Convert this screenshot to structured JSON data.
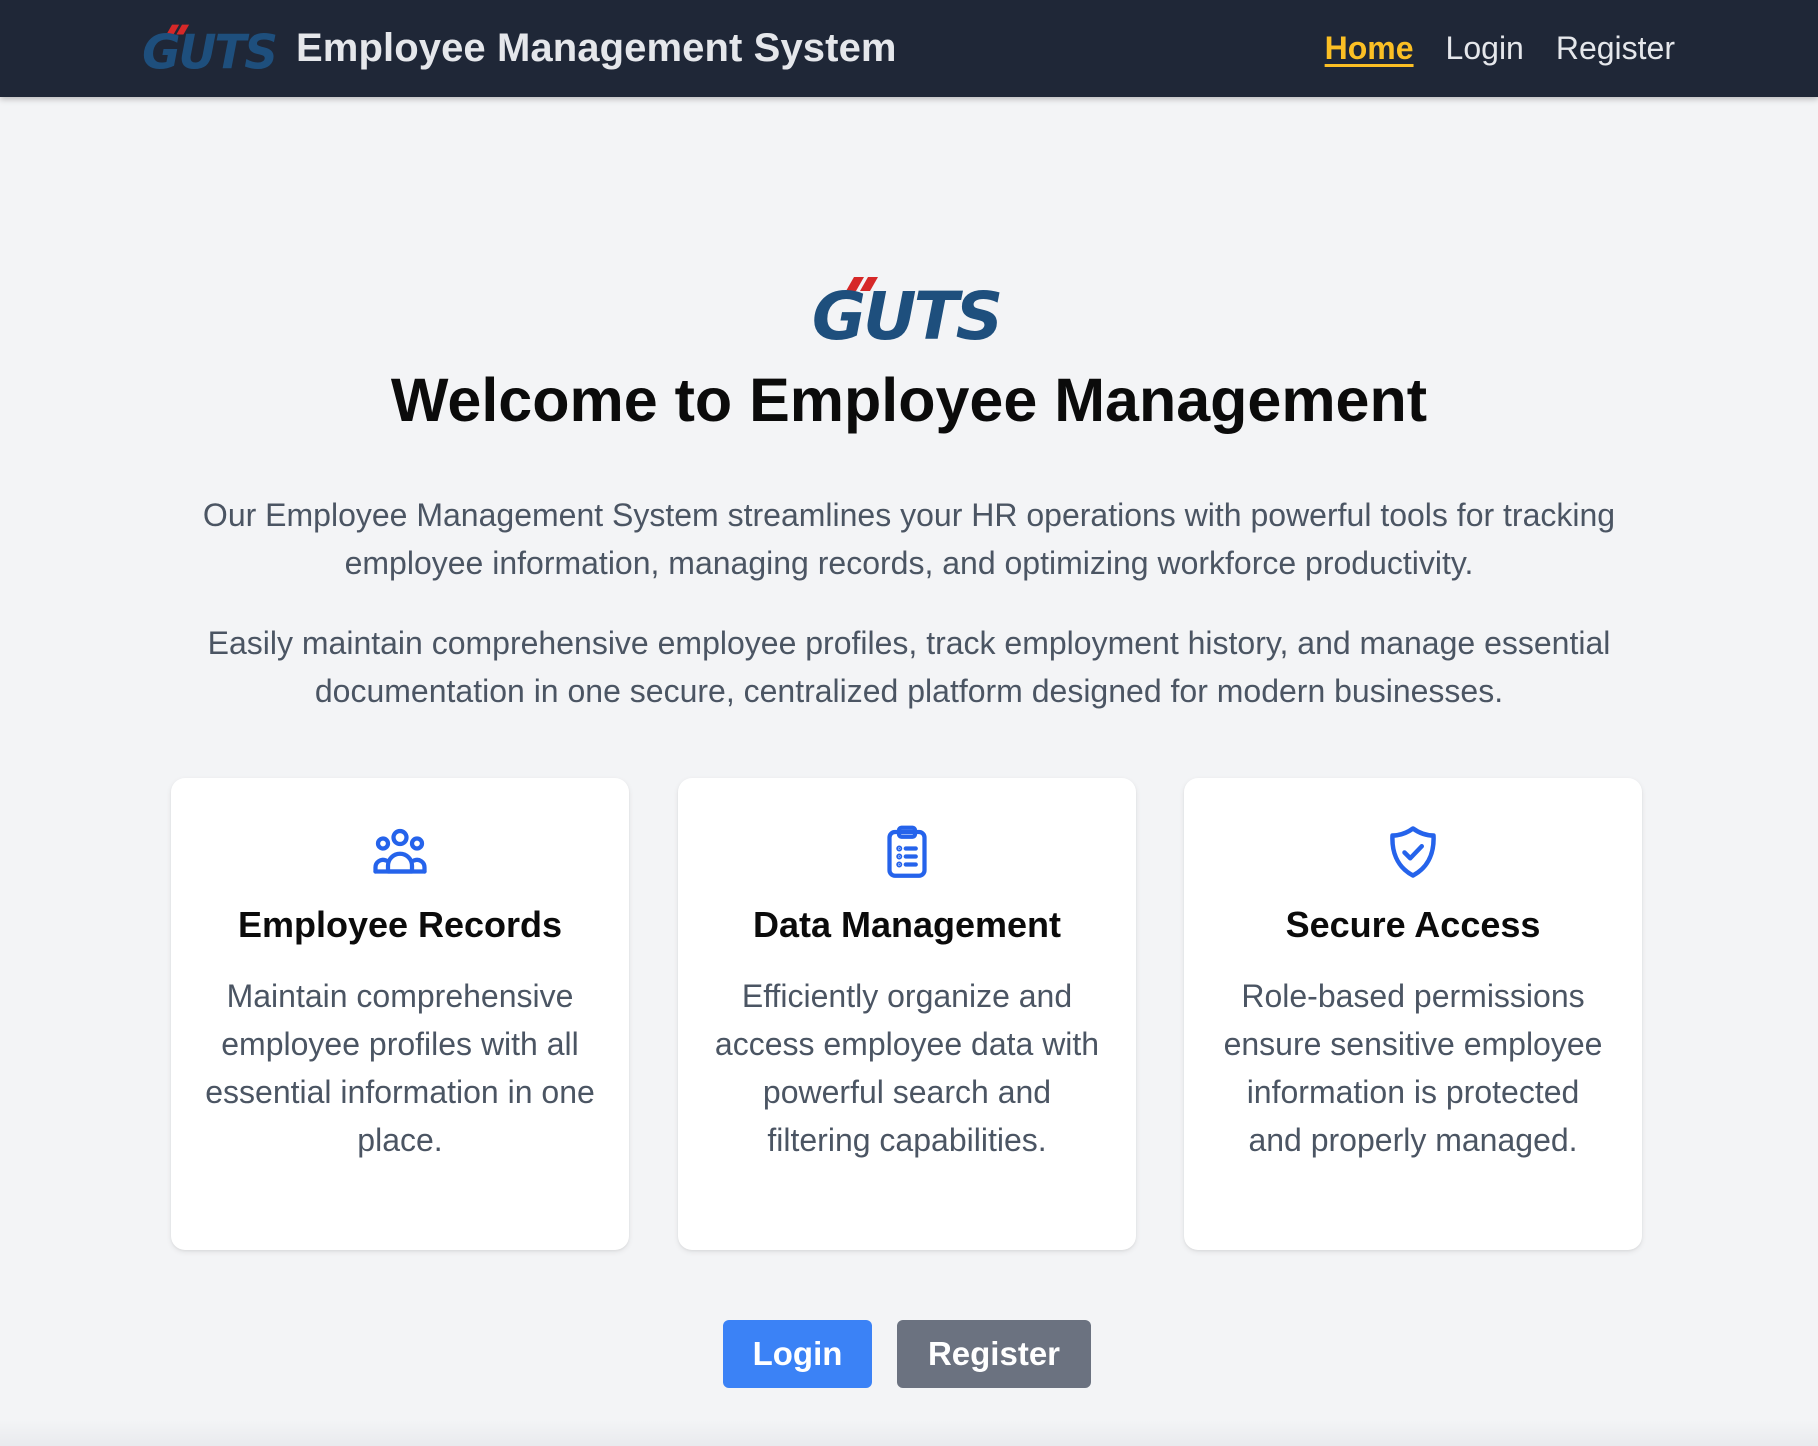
{
  "header": {
    "logo_text": "GUTS",
    "title": "Employee Management System",
    "nav": [
      {
        "label": "Home",
        "active": true
      },
      {
        "label": "Login",
        "active": false
      },
      {
        "label": "Register",
        "active": false
      }
    ]
  },
  "hero": {
    "logo_text": "GUTS",
    "title": "Welcome to Employee Management",
    "paragraph_1": "Our Employee Management System streamlines your HR operations with powerful tools for tracking employee information, managing records, and optimizing workforce productivity.",
    "paragraph_2": "Easily maintain comprehensive employee profiles, track employment history, and manage essential documentation in one secure, centralized platform designed for modern businesses."
  },
  "features": [
    {
      "icon": "user-group-icon",
      "title": "Employee Records",
      "description": "Maintain comprehensive employee profiles with all essential information in one place."
    },
    {
      "icon": "clipboard-list-icon",
      "title": "Data Management",
      "description": "Efficiently organize and access employee data with powerful search and filtering capabilities."
    },
    {
      "icon": "shield-check-icon",
      "title": "Secure Access",
      "description": "Role-based permissions ensure sensitive employee information is protected and properly managed."
    }
  ],
  "actions": {
    "login_label": "Login",
    "register_label": "Register"
  },
  "colors": {
    "navbar_bg": "#1f2737",
    "active_link": "#fbbf24",
    "brand_blue": "#1e4f7d",
    "brand_red": "#d62828",
    "icon_blue": "#2563eb",
    "login_button": "#3b82f6",
    "register_button": "#6b7280",
    "page_bg": "#f3f4f6"
  }
}
